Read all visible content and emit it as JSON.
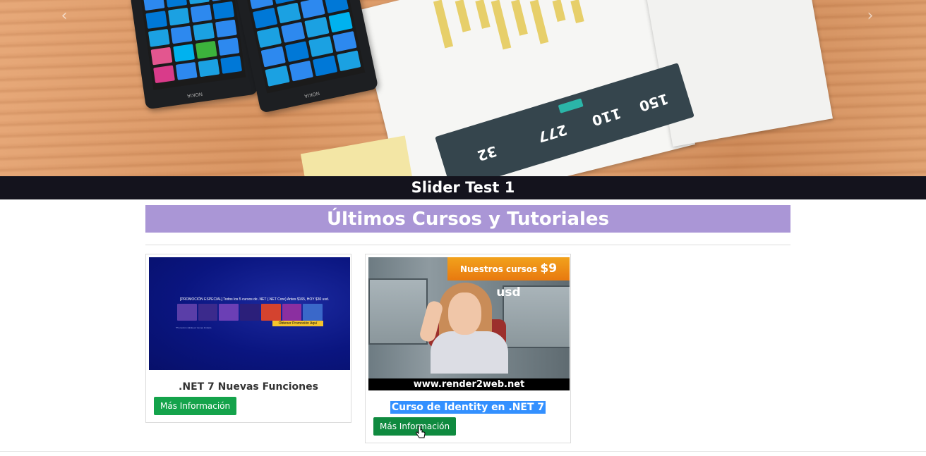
{
  "slider": {
    "caption": "Slider Test 1",
    "prev_glyph": "‹",
    "next_glyph": "›",
    "image_text": {
      "dash_numbers": [
        "150",
        "110",
        "277",
        "32"
      ],
      "phone_brand": "NOKIA"
    }
  },
  "section": {
    "title": "Últimos Cursos y Tutoriales"
  },
  "courses": [
    {
      "title": ".NET 7 Nuevas Funciones",
      "button_label": "Más Información",
      "thumbnail": {
        "headline": "[PROMOCIÓN ESPECIAL] Todos los 5 cursos de .NET (.NET Core) Antes $165, HOY $30 usd.",
        "cta": "Obtener Promoción Aquí",
        "fineprint": "*Promoción válida por tiempo limitado"
      }
    },
    {
      "title": "Curso de Identity en .NET 7",
      "button_label": "Más Información",
      "thumbnail": {
        "banner_prefix": "Nuestros cursos",
        "banner_price": "$9 usd",
        "footer": "www.render2web.net"
      }
    }
  ],
  "colors": {
    "caption_bg": "#14131d",
    "section_header_bg": "#aa96d6",
    "button_bg": "#14a34b",
    "selection": "#3390ff"
  }
}
